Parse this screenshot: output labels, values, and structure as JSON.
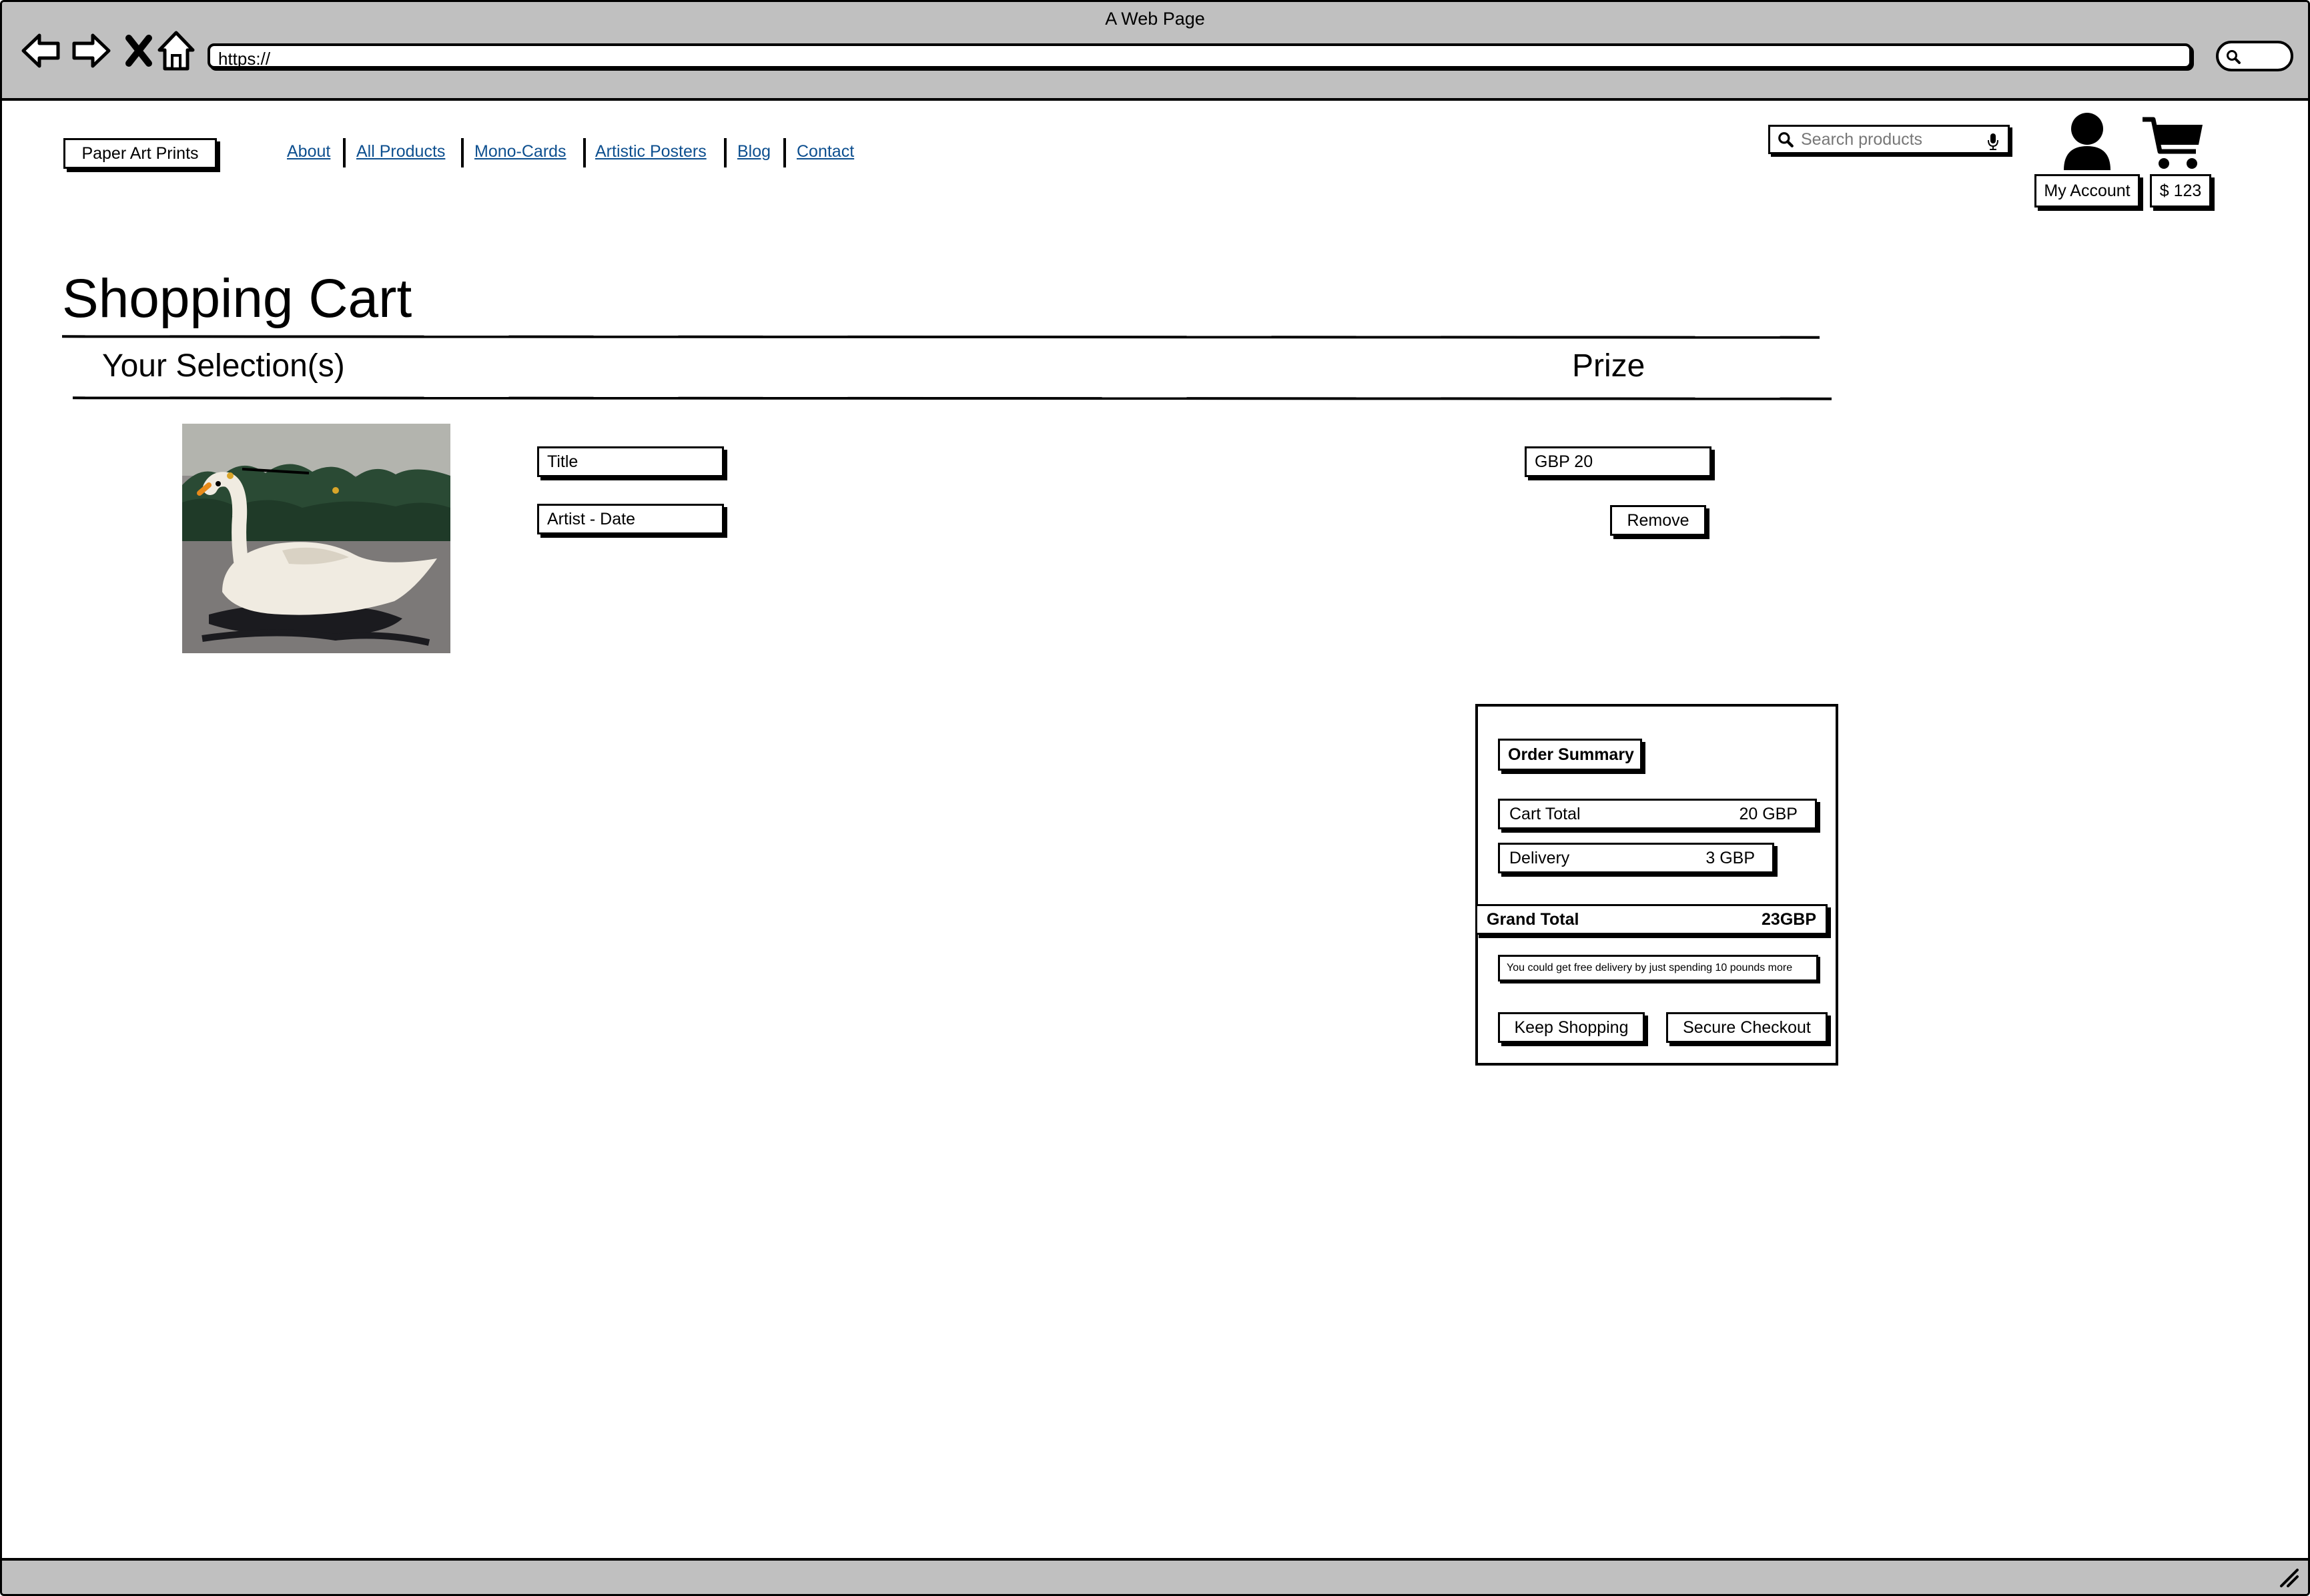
{
  "browser": {
    "window_title": "A Web Page",
    "url": "https://"
  },
  "header": {
    "logo": "Paper Art Prints",
    "nav": [
      {
        "label": "About"
      },
      {
        "label": "All Products"
      },
      {
        "label": "Mono-Cards"
      },
      {
        "label": "Artistic Posters"
      },
      {
        "label": "Blog"
      },
      {
        "label": "Contact"
      }
    ],
    "search_placeholder": "Search products",
    "account_label": "My Account",
    "cart_label": "$ 123"
  },
  "main": {
    "title": "Shopping Cart",
    "col_selection": "Your Selection(s)",
    "col_price": "Prize",
    "item": {
      "image_alt": "swan print",
      "title": "Title",
      "artist_date": "Artist - Date",
      "price": "GBP 20",
      "remove_label": "Remove"
    }
  },
  "summary": {
    "heading": "Order Summary",
    "cart_total_label": "Cart Total",
    "cart_total_value": "20 GBP",
    "delivery_label": "Delivery",
    "delivery_value": "3 GBP",
    "grand_total_label": "Grand Total",
    "grand_total_value": "23GBP",
    "free_delivery_note": "You could get free delivery by just spending 10 pounds more",
    "keep_shopping": "Keep Shopping",
    "secure_checkout": "Secure Checkout"
  },
  "icons": {
    "back": "arrow-left-icon",
    "forward": "arrow-right-icon",
    "stop": "close-icon",
    "home": "home-icon",
    "search": "search-icon",
    "mic": "microphone-icon",
    "user": "user-icon",
    "cart": "cart-icon",
    "resize": "resize-grip-icon"
  }
}
